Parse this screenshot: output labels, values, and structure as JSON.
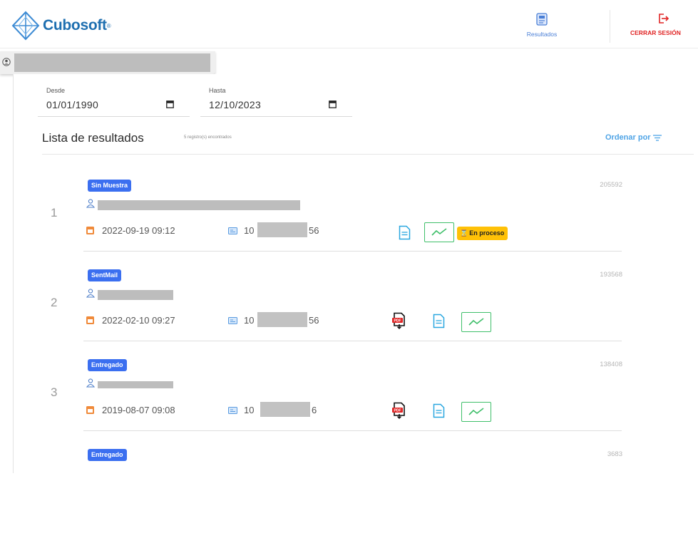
{
  "header": {
    "brand": "Cubosoft",
    "brand_mark": "®",
    "nav_results_label": "Resultados",
    "nav_logout_label": "CERRAR SESIÓN",
    "icons": {
      "results": "document-list-icon",
      "logout": "logout-icon"
    },
    "colors": {
      "brand": "#1e6fb0",
      "results": "#4a7fd6",
      "logout": "#e02424"
    }
  },
  "filters": {
    "from_label": "Desde",
    "from_value": "01/01/1990",
    "to_label": "Hasta",
    "to_value": "12/10/2023"
  },
  "list": {
    "title": "Lista de resultados",
    "count_text": "5 registro(s) encontrados",
    "sort_label": "Ordenar por",
    "colors": {
      "badge": "#3b6ff0",
      "status": "#ffc107",
      "chart_border": "#3fbf6a",
      "sort": "#4fa4e6"
    }
  },
  "results": [
    {
      "num": "1",
      "badge": "Sin Muestra",
      "order_id": "205592",
      "date": "2022-09-19 09:12",
      "id_prefix": "10",
      "id_suffix": "56",
      "status": "En proceso",
      "actions": [
        "doc-icon",
        "chart-icon"
      ]
    },
    {
      "num": "2",
      "badge": "SentMail",
      "order_id": "193568",
      "date": "2022-02-10 09:27",
      "id_prefix": "10",
      "id_suffix": "56",
      "actions": [
        "pdf-download-icon",
        "doc-icon",
        "chart-icon"
      ]
    },
    {
      "num": "3",
      "badge": "Entregado",
      "order_id": "138408",
      "date": "2019-08-07 09:08",
      "id_prefix": "10",
      "id_suffix": "6",
      "actions": [
        "pdf-download-icon",
        "doc-icon",
        "chart-icon"
      ]
    },
    {
      "num": "",
      "badge": "Entregado",
      "order_id": "3683"
    }
  ]
}
